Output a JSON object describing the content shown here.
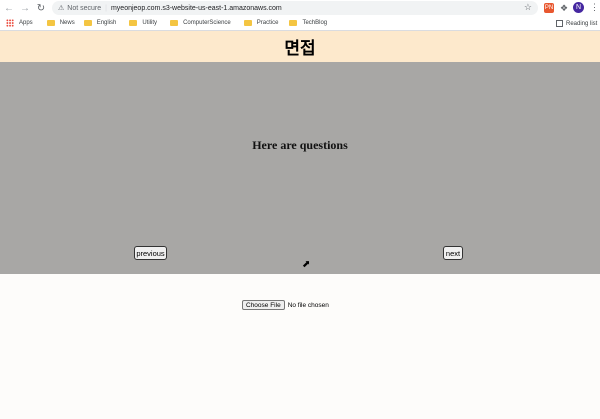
{
  "browser": {
    "security_label": "Not secure",
    "url": "myeonjeop.com.s3-website-us-east-1.amazonaws.com",
    "profile_initial": "N",
    "extension_label": "PN"
  },
  "bookmarks": {
    "items": [
      {
        "label": "Apps"
      },
      {
        "label": "News"
      },
      {
        "label": "English"
      },
      {
        "label": "Utility"
      },
      {
        "label": "ComputerScience"
      },
      {
        "label": "Practice"
      },
      {
        "label": "TechBlog"
      }
    ],
    "reading_list": "Reading list"
  },
  "page": {
    "title": "면접",
    "question": "Here are questions",
    "previous_label": "previous",
    "next_label": "next",
    "choose_file_label": "Choose File",
    "file_status": "No file chosen"
  },
  "colors": {
    "header_bg": "#fde9cc",
    "panel_bg": "#a8a7a5",
    "page_bg": "#fdfcfa"
  }
}
